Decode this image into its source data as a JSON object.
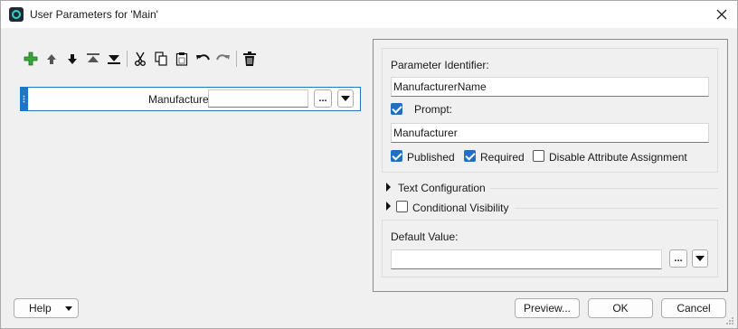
{
  "window": {
    "title": "User Parameters for 'Main'"
  },
  "toolbar": {
    "icons": [
      "add-icon",
      "move-up-icon",
      "move-down-icon",
      "move-top-icon",
      "move-bottom-icon",
      "cut-icon",
      "copy-icon",
      "paste-icon",
      "undo-icon",
      "redo-icon",
      "delete-icon"
    ]
  },
  "parameter": {
    "label": "Manufacturer:",
    "required_mark": "*",
    "value": "",
    "ellipsis": "..."
  },
  "properties": {
    "identifier_label": "Parameter Identifier:",
    "identifier_value": "ManufacturerName",
    "prompt_label": "Prompt:",
    "prompt_checked": true,
    "prompt_value": "Manufacturer",
    "published_label": "Published",
    "published_checked": true,
    "required_label": "Required",
    "required_checked": true,
    "disable_attr_label": "Disable Attribute Assignment",
    "disable_attr_checked": false,
    "text_config_label": "Text Configuration",
    "cond_visibility_label": "Conditional Visibility",
    "cond_visibility_checked": false,
    "default_value_label": "Default Value:",
    "default_value": "",
    "ellipsis": "..."
  },
  "footer": {
    "help_label": "Help",
    "preview_label": "Preview...",
    "ok_label": "OK",
    "cancel_label": "Cancel"
  },
  "colors": {
    "accent": "#1f6fc5",
    "selection_border": "#1f76c6",
    "required_star": "#dd1111",
    "add_icon_green": "#2e9b2e"
  }
}
